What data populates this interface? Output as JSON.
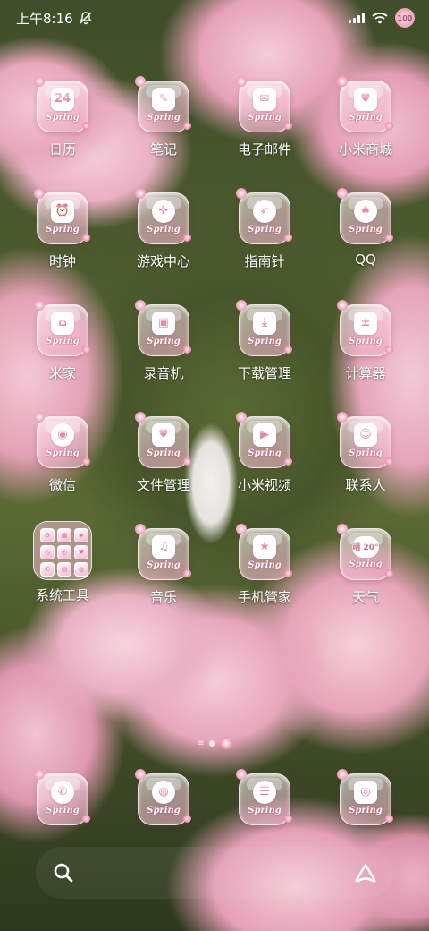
{
  "status_bar": {
    "time": "上午8:16",
    "battery_level": "100"
  },
  "tile_caption": "Spring",
  "apps": [
    {
      "label": "日历",
      "glyph": "24",
      "icon": "calendar-icon"
    },
    {
      "label": "笔记",
      "glyph": "✎",
      "icon": "notes-icon"
    },
    {
      "label": "电子邮件",
      "glyph": "✉",
      "icon": "mail-icon"
    },
    {
      "label": "小米商城",
      "glyph": "♥",
      "icon": "shopping-bag-icon"
    },
    {
      "label": "时钟",
      "glyph": "⏰",
      "icon": "clock-icon"
    },
    {
      "label": "游戏中心",
      "glyph": "✜",
      "icon": "gamepad-icon"
    },
    {
      "label": "指南针",
      "glyph": "➶",
      "icon": "compass-icon"
    },
    {
      "label": "QQ",
      "glyph": "♠",
      "icon": "qq-penguin-icon"
    },
    {
      "label": "米家",
      "glyph": "⌂",
      "icon": "mijia-icon"
    },
    {
      "label": "录音机",
      "glyph": "▣",
      "icon": "recorder-icon"
    },
    {
      "label": "下载管理",
      "glyph": "⤓",
      "icon": "download-icon"
    },
    {
      "label": "计算器",
      "glyph": "±",
      "icon": "calculator-icon"
    },
    {
      "label": "微信",
      "glyph": "◉",
      "icon": "wechat-icon"
    },
    {
      "label": "文件管理",
      "glyph": "♥",
      "icon": "folder-icon"
    },
    {
      "label": "小米视频",
      "glyph": "▶",
      "icon": "video-camera-icon"
    },
    {
      "label": "联系人",
      "glyph": "☺",
      "icon": "contacts-icon"
    },
    {
      "label": "系统工具",
      "glyph": "",
      "icon": "folder-system-tools-icon"
    },
    {
      "label": "音乐",
      "glyph": "♫",
      "icon": "headphones-icon"
    },
    {
      "label": "手机管家",
      "glyph": "★",
      "icon": "shield-icon"
    },
    {
      "label": "天气",
      "glyph": "晴 20°",
      "icon": "weather-icon"
    }
  ],
  "dock": [
    {
      "label": "Phone",
      "glyph": "✆",
      "icon": "phone-icon"
    },
    {
      "label": "Browser",
      "glyph": "◍",
      "icon": "browser-globe-icon"
    },
    {
      "label": "Messages",
      "glyph": "☰",
      "icon": "message-icon"
    },
    {
      "label": "Camera",
      "glyph": "◎",
      "icon": "camera-icon"
    }
  ],
  "accent_colors": {
    "tile_pink": "#f0b9cc",
    "glyph_pink": "#e58aa6"
  }
}
